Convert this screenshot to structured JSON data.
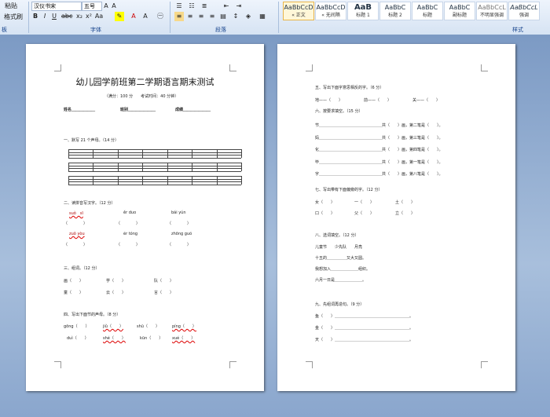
{
  "ribbon": {
    "clipboard": {
      "paste": "粘贴",
      "format_painter": "格式刷",
      "label": "板"
    },
    "font": {
      "name": "汉仪书宋",
      "size": "五号",
      "label": "字体"
    },
    "paragraph": {
      "label": "段落"
    },
    "styles": {
      "label": "样式",
      "items": [
        {
          "sample": "AaBbCcD",
          "name": "« 正文"
        },
        {
          "sample": "AaBbCcD",
          "name": "« 无间隔"
        },
        {
          "sample": "AaB",
          "name": "标题 1"
        },
        {
          "sample": "AaBbC",
          "name": "标题 2"
        },
        {
          "sample": "AaBbC",
          "name": "标题"
        },
        {
          "sample": "AaBbC",
          "name": "副标题"
        },
        {
          "sample": "AaBbCcL",
          "name": "不明显强调"
        },
        {
          "sample": "AaBbCcL",
          "name": "强调"
        }
      ]
    }
  },
  "page1": {
    "title": "幼儿园学前班第二学期语言期末测试",
    "subtitle": "（满分：100 分　　考试时间：40 分钟）",
    "info": {
      "name": "姓名",
      "class": "班别",
      "score": "成绩"
    },
    "q1": "一、默写 21 个声母。（14 分）",
    "q2": "二、读拼音写汉字。（12 分）",
    "q2_pinyin_row1": [
      "suǒ　sī",
      "ěr duo",
      "bái yún"
    ],
    "q2_pinyin_row2": [
      "zuǒ yòu",
      "ér tóng",
      "zhōng guó"
    ],
    "q3": "三、组词。（12 分）",
    "q3_row1": [
      "画（　　）",
      "学（　　）",
      "队（　　）"
    ],
    "q3_row2": [
      "童（　　）",
      "云（　　）",
      "言（　　）"
    ],
    "q4": "四、写出下面节的声母。（8 分）",
    "q4_row1": [
      "gōng（　　）",
      "jiǔ（　　）",
      "shū（　　）",
      "píng（　　）"
    ],
    "q4_row2": [
      "duì（　　）",
      "shé（　　）",
      "kūn（　　）",
      "xué（　　）"
    ]
  },
  "page2": {
    "q5": "五、写出下面字意思相反的字。（6 分）",
    "q5_row": [
      "地——（　　）",
      "前——（　　）",
      "关——（　　）"
    ],
    "q6": "六、按要求填空。（15 分）",
    "q6_rows": [
      {
        "ch": "节",
        "tail": "共（　　）画，第二笔是（　　）。"
      },
      {
        "ch": "妈",
        "tail": "共（　　）画，第三笔是（　　）。"
      },
      {
        "ch": "化",
        "tail": "共（　　）画，第四笔是（　　）。"
      },
      {
        "ch": "毕",
        "tail": "共（　　）画，第一笔是（　　）。"
      },
      {
        "ch": "字",
        "tail": "共（　　）画，第八笔是（　　）。"
      }
    ],
    "q7": "七、写出带有下面偏旁的字。（12 分）",
    "q7_row1": [
      "女（　　）",
      "一（　　）",
      "土（　　）"
    ],
    "q7_row2": [
      "口（　　）",
      "父（　　）",
      "立（　　）"
    ],
    "q8": "八、选词填空。（12 分）",
    "q8_words": "儿童节　　少先队　　月亮",
    "q8_lines": [
      "十五的＿＿＿＿＿又大又圆。",
      "我想加入＿＿＿＿＿＿＿组织。",
      "六月一日是＿＿＿＿＿＿＿。"
    ],
    "q9": "九、先组词再造句。（9 分）",
    "q9_rows": [
      "鱼（　　）",
      "金（　　）",
      "天（　　）"
    ]
  }
}
